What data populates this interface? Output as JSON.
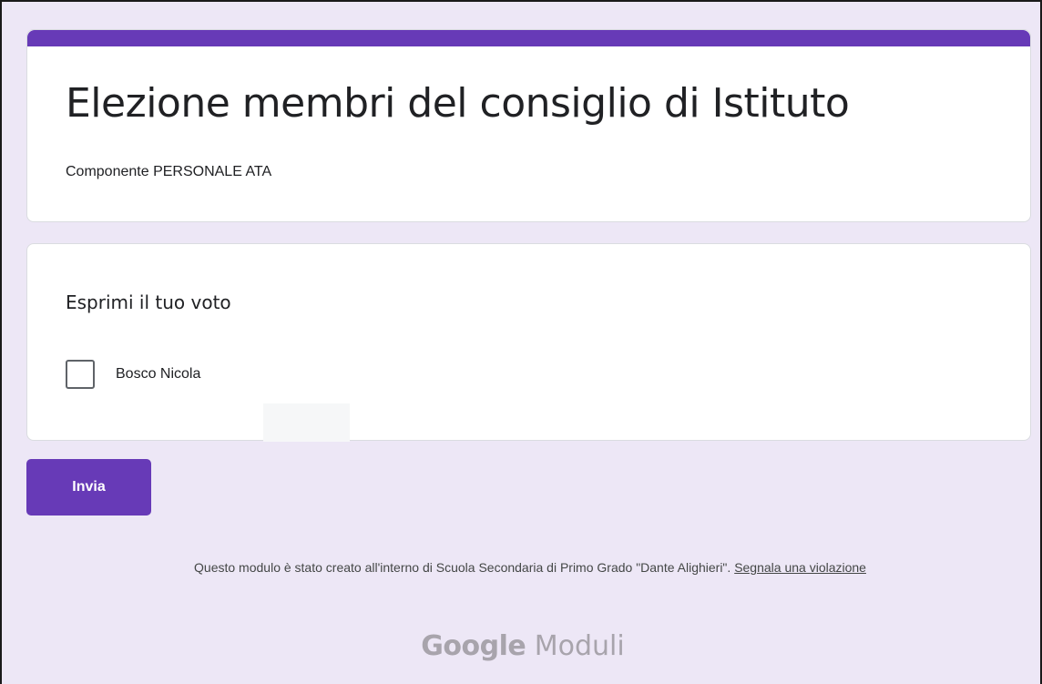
{
  "form": {
    "title": "Elezione membri del consiglio di Istituto",
    "description": "Componente PERSONALE ATA",
    "accent_color": "#673ab7"
  },
  "question": {
    "title": "Esprimi il tuo voto",
    "options": [
      {
        "label": "Bosco Nicola",
        "checked": false
      }
    ]
  },
  "actions": {
    "submit_label": "Invia"
  },
  "footer": {
    "note": "Questo modulo è stato creato all'interno di Scuola Secondaria di Primo Grado \"Dante Alighieri\". ",
    "report_link": "Segnala una violazione"
  },
  "branding": {
    "google": "Google",
    "product": "Moduli"
  }
}
